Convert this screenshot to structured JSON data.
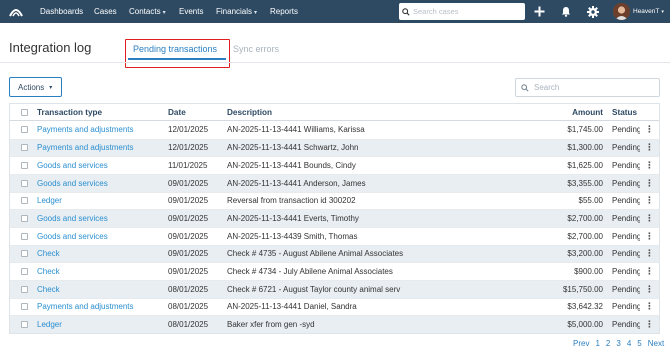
{
  "nav": {
    "items": [
      {
        "label": "Dashboards",
        "has_caret": false
      },
      {
        "label": "Cases",
        "has_caret": false
      },
      {
        "label": "Contacts",
        "has_caret": true
      },
      {
        "label": "Events",
        "has_caret": false
      },
      {
        "label": "Financials",
        "has_caret": true
      },
      {
        "label": "Reports",
        "has_caret": false
      }
    ],
    "search_placeholder": "Search cases",
    "user_name": "HeavenT",
    "caret_glyph": "▾"
  },
  "page": {
    "title": "Integration log",
    "tabs": [
      {
        "label": "Pending transactions",
        "active": true
      },
      {
        "label": "Sync errors",
        "active": false
      }
    ]
  },
  "toolbar": {
    "actions_label": "Actions",
    "search_placeholder": "Search"
  },
  "table": {
    "headers": {
      "type": "Transaction type",
      "date": "Date",
      "description": "Description",
      "amount": "Amount",
      "status": "Status"
    },
    "rows": [
      {
        "type": "Payments and adjustments",
        "date": "12/01/2025",
        "description": "AN-2025-11-13-4441 Williams, Karissa",
        "amount": "$1,745.00",
        "status": "Pending"
      },
      {
        "type": "Payments and adjustments",
        "date": "12/01/2025",
        "description": "AN-2025-11-13-4441 Schwartz, John",
        "amount": "$1,300.00",
        "status": "Pending"
      },
      {
        "type": "Goods and services",
        "date": "11/01/2025",
        "description": "AN-2025-11-13-4441 Bounds, Cindy",
        "amount": "$1,625.00",
        "status": "Pending"
      },
      {
        "type": "Goods and services",
        "date": "09/01/2025",
        "description": "AN-2025-11-13-4441 Anderson, James",
        "amount": "$3,355.00",
        "status": "Pending"
      },
      {
        "type": "Ledger",
        "date": "09/01/2025",
        "description": "Reversal from transaction id 300202",
        "amount": "$55.00",
        "status": "Pending"
      },
      {
        "type": "Goods and services",
        "date": "09/01/2025",
        "description": "AN-2025-11-13-4441 Everts, Timothy",
        "amount": "$2,700.00",
        "status": "Pending"
      },
      {
        "type": "Goods and services",
        "date": "09/01/2025",
        "description": "AN-2025-11-13-4439 Smith, Thomas",
        "amount": "$2,700.00",
        "status": "Pending"
      },
      {
        "type": "Check",
        "date": "09/01/2025",
        "description": "Check # 4735 - August Abilene Animal Associates",
        "amount": "$3,200.00",
        "status": "Pending"
      },
      {
        "type": "Check",
        "date": "09/01/2025",
        "description": "Check # 4734 - July Abilene Animal Associates",
        "amount": "$900.00",
        "status": "Pending"
      },
      {
        "type": "Check",
        "date": "08/01/2025",
        "description": "Check # 6721 - August Taylor county animal serv",
        "amount": "$15,750.00",
        "status": "Pending"
      },
      {
        "type": "Payments and adjustments",
        "date": "08/01/2025",
        "description": "AN-2025-11-13-4441 Daniel, Sandra",
        "amount": "$3,642.32",
        "status": "Pending"
      },
      {
        "type": "Ledger",
        "date": "08/01/2025",
        "description": "Baker xfer from gen -syd",
        "amount": "$5,000.00",
        "status": "Pending"
      }
    ]
  },
  "pagination": {
    "prev": "Prev",
    "pages": [
      "1",
      "2",
      "3",
      "4",
      "5"
    ],
    "next": "Next"
  },
  "colors": {
    "nav_bg": "#2e4a63",
    "link": "#2a8fd0",
    "accent": "#2a7fc1",
    "highlight": "#e02020",
    "row_alt": "#e9eef2"
  }
}
